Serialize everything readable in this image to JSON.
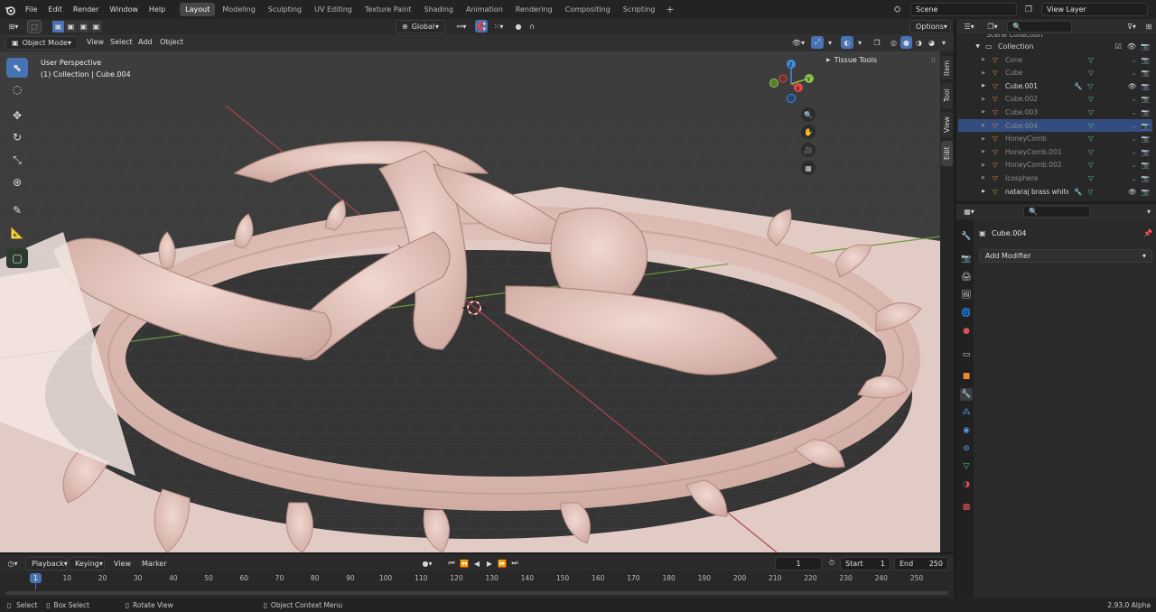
{
  "top_menu": [
    "File",
    "Edit",
    "Render",
    "Window",
    "Help"
  ],
  "workspaces": [
    "Layout",
    "Modeling",
    "Sculpting",
    "UV Editing",
    "Texture Paint",
    "Shading",
    "Animation",
    "Rendering",
    "Compositing",
    "Scripting"
  ],
  "add_workspace": "+",
  "scene": {
    "label": "Scene"
  },
  "view_layer": {
    "label": "View Layer"
  },
  "viewport_header": {
    "mode": "Object Mode",
    "menus": [
      "View",
      "Select",
      "Add",
      "Object"
    ],
    "orientation": "Global",
    "options": "Options"
  },
  "viewport": {
    "perspective": "User Perspective",
    "object_info": "(1) Collection | Cube.004",
    "tissue_tools": "Tissue Tools",
    "side_tabs": [
      "Item",
      "Tool",
      "View",
      "Edit"
    ]
  },
  "gizmo": {
    "x": "X",
    "y": "Y",
    "z": "Z"
  },
  "outliner": {
    "top": "Scene Collection",
    "collection": "Collection",
    "rows": [
      {
        "name": "Cone",
        "dim": true,
        "sel": false
      },
      {
        "name": "Cube",
        "dim": true,
        "sel": false
      },
      {
        "name": "Cube.001",
        "dim": false,
        "sel": false
      },
      {
        "name": "Cube.002",
        "dim": true,
        "sel": false
      },
      {
        "name": "Cube.003",
        "dim": true,
        "sel": false
      },
      {
        "name": "Cube.004",
        "dim": true,
        "sel": true
      },
      {
        "name": "HoneyComb",
        "dim": true,
        "sel": false
      },
      {
        "name": "HoneyComb.001",
        "dim": true,
        "sel": false
      },
      {
        "name": "HoneyComb.002",
        "dim": true,
        "sel": false
      },
      {
        "name": "Icosphere",
        "dim": true,
        "sel": false
      },
      {
        "name": "nataraj brass white SQ",
        "dim": false,
        "sel": false
      }
    ]
  },
  "properties": {
    "object": "Cube.004",
    "add_modifier": "Add Modifier"
  },
  "timeline": {
    "menus": [
      "Playback",
      "Keying",
      "View",
      "Marker"
    ],
    "current_frame": "1",
    "start_label": "Start",
    "start": "1",
    "end_label": "End",
    "end": "250",
    "ticks": [
      "1",
      "10",
      "20",
      "30",
      "40",
      "50",
      "60",
      "70",
      "80",
      "90",
      "100",
      "110",
      "120",
      "130",
      "140",
      "150",
      "160",
      "170",
      "180",
      "190",
      "200",
      "210",
      "220",
      "230",
      "240",
      "250"
    ]
  },
  "statusbar": {
    "items": [
      "Select",
      "Box Select",
      "Rotate View",
      "Object Context Menu"
    ],
    "version": "2.93.0 Alpha"
  },
  "colors": {
    "accent": "#4772b3",
    "selection": "#334d80",
    "x_axis": "#e0494d",
    "y_axis": "#8bc34a",
    "z_axis": "#3f8fe0",
    "model": "#e8cdc6"
  }
}
